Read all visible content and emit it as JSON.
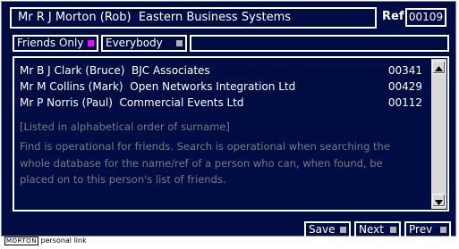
{
  "header": {
    "title": "Mr R J Morton (Rob)  Eastern Business Systems",
    "ref_label": "Ref",
    "ref_value": "00109"
  },
  "filters": {
    "friends_only": "Friends Only",
    "everybody": "Everybody",
    "search_value": ""
  },
  "colors": {
    "background": "#000d45",
    "friends_indicator": "#ff00ff",
    "everybody_indicator": "#b0b0b0",
    "note_text": "#7a7a7a"
  },
  "list": {
    "rows": [
      {
        "name": "Mr B J Clark (Bruce)  BJC Associates",
        "ref": "00341"
      },
      {
        "name": "Mr M Collins (Mark)  Open Networks Integration Ltd",
        "ref": "00429"
      },
      {
        "name": "Mr P Norris (Paul)  Commercial Events Ltd",
        "ref": "00112"
      }
    ],
    "note_order": "[Listed in alphabetical order of surname]",
    "note_info": "Find is operational for friends. Search is operational when searching the whole database for the name/ref of a person who can, when found, be placed on to this person's list of friends."
  },
  "actions": {
    "save": "Save",
    "next": "Next",
    "prev": "Prev"
  },
  "footer": {
    "logo": "MORTON",
    "text": "personal link"
  }
}
